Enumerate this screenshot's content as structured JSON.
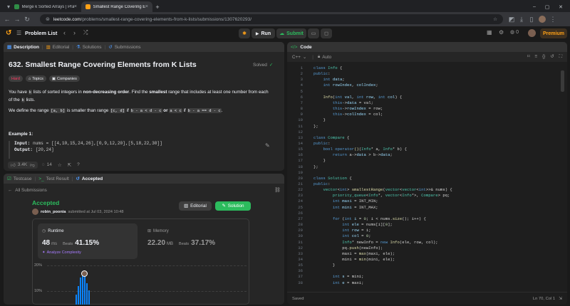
{
  "browser": {
    "tabs": [
      {
        "title": "Merge k Sorted Arrays | Practi",
        "fav_color": "#2f8d46"
      },
      {
        "title": "Smallest Range Covering Elem",
        "fav_color": "#ffa116"
      }
    ],
    "url_domain": "leetcode.com",
    "url_path": "/problems/smallest-range-covering-elements-from-k-lists/submissions/1307620293/"
  },
  "topbar": {
    "problem_list": "Problem List",
    "run_label": "Run",
    "submit_label": "Submit",
    "coins": "0",
    "premium_label": "Premium"
  },
  "left_tabs": [
    "Description",
    "Editorial",
    "Solutions",
    "Submissions"
  ],
  "problem": {
    "title": "632. Smallest Range Covering Elements from K Lists",
    "status": "Solved",
    "difficulty": "Hard",
    "topics_label": "Topics",
    "companies_label": "Companies",
    "desc1_a": "You have",
    "desc1_k": "k",
    "desc1_b": "lists of sorted integers in",
    "desc1_bold": "non-decreasing order",
    "desc1_c": ". Find the",
    "desc1_bold2": "smallest",
    "desc1_d": "range that includes at least one number from each",
    "desc1_e": "of the",
    "desc1_k2": "k",
    "desc1_f": "lists.",
    "desc2_a": "We define the range",
    "desc2_ab": "[a, b]",
    "desc2_b": "is smaller than range",
    "desc2_cd": "[c, d]",
    "desc2_c": "if",
    "desc2_cond1": "b - a < d - c",
    "desc2_or": "or",
    "desc2_cond2": "a < c",
    "desc2_if": "if",
    "desc2_cond3": "b - a == d - c",
    "desc2_end": ".",
    "example_title": "Example 1:",
    "input_label": "Input:",
    "input_value": "nums = [[4,10,15,24,26],[0,9,12,20],[5,18,22,30]]",
    "output_label": "Output:",
    "output_value": "[20,24]",
    "likes": "3.4K",
    "comments": "14"
  },
  "bottom_tabs": [
    "Testcase",
    "Test Result",
    "Accepted"
  ],
  "submission": {
    "back_label": "All Submissions",
    "status": "Accepted",
    "user": "robin_poonia",
    "submitted_at": "submitted at Jul 03, 2024 10:48",
    "editorial_btn": "Editorial",
    "solution_btn": "Solution",
    "runtime_label": "Runtime",
    "runtime_value": "48",
    "runtime_unit": "ms",
    "beats_label": "Beats",
    "runtime_beats": "41.15%",
    "analyze_label": "Analyze Complexity",
    "memory_label": "Memory",
    "memory_value": "22.20",
    "memory_unit": "MB",
    "memory_beats": "37.17%",
    "chart_ticks": [
      "20%",
      "10%"
    ]
  },
  "editor": {
    "title": "Code",
    "language": "C++",
    "autocomplete": "Auto",
    "status_left": "Saved",
    "status_right": "Ln 70, Col 1",
    "lines": [
      {
        "n": "1",
        "h": "<span class='kw'>class</span> <span class='tp'>Info</span> <span class='tx'>{</span>"
      },
      {
        "n": "2",
        "h": "<span class='kw'>public</span><span class='tx'>:</span>"
      },
      {
        "n": "3",
        "h": "    <span class='kw'>int</span> <span class='vr'>data</span><span class='tx'>;</span>"
      },
      {
        "n": "4",
        "h": "    <span class='kw'>int</span> <span class='vr'>rowIndex</span><span class='tx'>, </span><span class='vr'>colIndex</span><span class='tx'>;</span>"
      },
      {
        "n": "5",
        "h": ""
      },
      {
        "n": "6",
        "h": "    <span class='fn'>Info</span><span class='tx'>(</span><span class='kw'>int</span> <span class='vr'>val</span><span class='tx'>, </span><span class='kw'>int</span> <span class='vr'>row</span><span class='tx'>, </span><span class='kw'>int</span> <span class='vr'>col</span><span class='tx'>) {</span>"
      },
      {
        "n": "7",
        "h": "        <span class='kw'>this</span><span class='tx'>-&gt;</span><span class='vr'>data</span> <span class='tx'>= val;</span>"
      },
      {
        "n": "8",
        "h": "        <span class='kw'>this</span><span class='tx'>-&gt;</span><span class='vr'>rowIndex</span> <span class='tx'>= row;</span>"
      },
      {
        "n": "9",
        "h": "        <span class='kw'>this</span><span class='tx'>-&gt;</span><span class='vr'>colIndex</span> <span class='tx'>= col;</span>"
      },
      {
        "n": "10",
        "h": "    <span class='tx'>}</span>"
      },
      {
        "n": "11",
        "h": "<span class='tx'>};</span>"
      },
      {
        "n": "12",
        "h": ""
      },
      {
        "n": "13",
        "h": "<span class='kw'>class</span> <span class='tp'>Compare</span> <span class='tx'>{</span>"
      },
      {
        "n": "14",
        "h": "<span class='kw'>public</span><span class='tx'>:</span>"
      },
      {
        "n": "15",
        "h": "    <span class='kw'>bool</span> <span class='kw'>operator</span><span class='fn'>()</span><span class='tx'>(</span><span class='tp'>Info</span><span class='tx'>* a, </span><span class='tp'>Info</span><span class='tx'>* b) {</span>"
      },
      {
        "n": "16",
        "h": "        <span class='kw'>return</span> <span class='tx'>a-&gt;</span><span class='vr'>data</span> <span class='tx'>&gt; b-&gt;</span><span class='vr'>data</span><span class='tx'>;</span>"
      },
      {
        "n": "17",
        "h": "    <span class='tx'>}</span>"
      },
      {
        "n": "18",
        "h": "<span class='tx'>};</span>"
      },
      {
        "n": "19",
        "h": ""
      },
      {
        "n": "20",
        "h": "<span class='kw'>class</span> <span class='tp'>Solution</span> <span class='tx'>{</span>"
      },
      {
        "n": "21",
        "h": "<span class='kw'>public</span><span class='tx'>:</span>"
      },
      {
        "n": "22",
        "h": "    <span class='tp'>vector</span><span class='tx'>&lt;</span><span class='kw'>int</span><span class='tx'>&gt; </span><span class='fn'>smallestRange</span><span class='tx'>(</span><span class='tp'>vector</span><span class='tx'>&lt;</span><span class='tp'>vector</span><span class='tx'>&lt;</span><span class='kw'>int</span><span class='tx'>&gt;&gt;&amp; nums) {</span>"
      },
      {
        "n": "23",
        "h": "        <span class='tp'>priority_queue</span><span class='tx'>&lt;</span><span class='tp'>Info</span><span class='tx'>*, </span><span class='tp'>vector</span><span class='tx'>&lt;</span><span class='tp'>Info</span><span class='tx'>*&gt;, </span><span class='tp'>Compare</span><span class='tx'>&gt; pq;</span>"
      },
      {
        "n": "24",
        "h": "        <span class='kw'>int</span> <span class='vr'>maxi</span> <span class='tx'>= INT_MIN;</span>"
      },
      {
        "n": "25",
        "h": "        <span class='kw'>int</span> <span class='vr'>mini</span> <span class='tx'>= INT_MAX;</span>"
      },
      {
        "n": "26",
        "h": ""
      },
      {
        "n": "27",
        "h": "        <span class='kw'>for</span> <span class='tx'>(</span><span class='kw'>int</span> <span class='vr'>i</span> <span class='tx'>= </span><span class='nm'>0</span><span class='tx'>; i &lt; nums.</span><span class='fn'>size</span><span class='tx'>(); i++) {</span>"
      },
      {
        "n": "28",
        "h": "            <span class='kw'>int</span> <span class='vr'>ele</span> <span class='tx'>= nums[i][</span><span class='nm'>0</span><span class='tx'>];</span>"
      },
      {
        "n": "29",
        "h": "            <span class='kw'>int</span> <span class='vr'>row</span> <span class='tx'>= i;</span>"
      },
      {
        "n": "30",
        "h": "            <span class='kw'>int</span> <span class='vr'>col</span> <span class='tx'>= </span><span class='nm'>0</span><span class='tx'>;</span>"
      },
      {
        "n": "31",
        "h": "            <span class='tp'>Info</span><span class='tx'>* newInfo = </span><span class='kw'>new</span> <span class='fn'>Info</span><span class='tx'>(ele, row, col);</span>"
      },
      {
        "n": "32",
        "h": "            <span class='tx'>pq.</span><span class='fn'>push</span><span class='tx'>(newInfo);</span>"
      },
      {
        "n": "33",
        "h": "            <span class='tx'>maxi = </span><span class='fn'>max</span><span class='tx'>(maxi, ele);</span>"
      },
      {
        "n": "34",
        "h": "            <span class='tx'>mini = </span><span class='fn'>min</span><span class='tx'>(mini, ele);</span>"
      },
      {
        "n": "35",
        "h": "        <span class='tx'>}</span>"
      },
      {
        "n": "36",
        "h": ""
      },
      {
        "n": "37",
        "h": "        <span class='kw'>int</span> <span class='vr'>s</span> <span class='tx'>= mini;</span>"
      },
      {
        "n": "38",
        "h": "        <span class='kw'>int</span> <span class='vr'>e</span> <span class='tx'>= maxi;</span>"
      }
    ]
  }
}
